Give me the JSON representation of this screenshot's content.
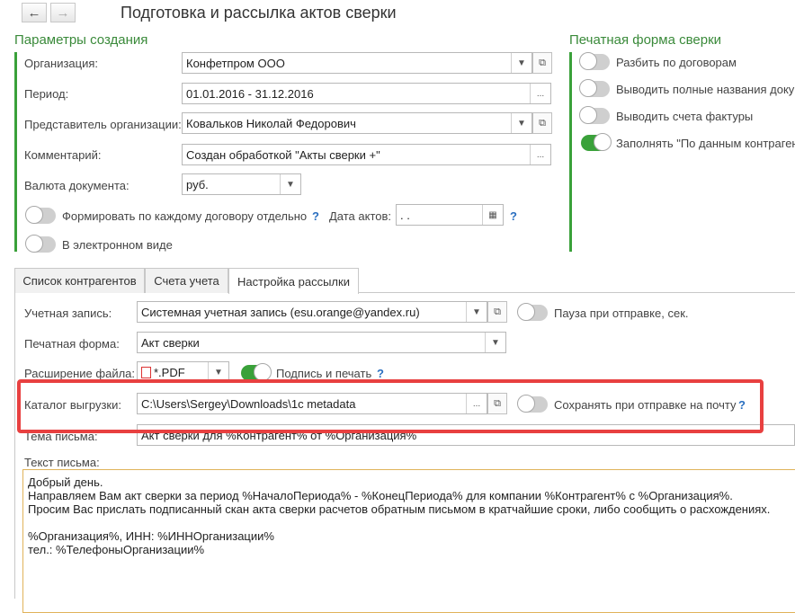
{
  "window": {
    "title": "Подготовка и рассылка актов сверки"
  },
  "nav": {
    "back": "←",
    "forward": "→"
  },
  "params": {
    "title": "Параметры создания",
    "org_label": "Организация:",
    "org_value": "Конфетпром ООО",
    "period_label": "Период:",
    "period_value": "01.01.2016 - 31.12.2016",
    "rep_label": "Представитель организации:",
    "rep_value": "Ковальков Николай Федорович",
    "comment_label": "Комментарий:",
    "comment_value": "Создан обработкой \"Акты сверки +\"",
    "currency_label": "Валюта документа:",
    "currency_value": "руб.",
    "each_contract_label": "Формировать по каждому договору отдельно",
    "acts_date_label": "Дата актов:",
    "acts_date_value": " .  .",
    "electronic_label": "В электронном виде"
  },
  "print_form": {
    "title": "Печатная форма сверки",
    "items": [
      {
        "label": "Разбить по договорам",
        "on": false
      },
      {
        "label": "Выводить полные названия документов",
        "on": false
      },
      {
        "label": "Выводить счета фактуры",
        "on": false
      },
      {
        "label": "Заполнять \"По данным контрагента\"",
        "on": true
      }
    ]
  },
  "tabs": [
    {
      "label": "Список контрагентов",
      "active": false
    },
    {
      "label": "Счета учета",
      "active": false
    },
    {
      "label": "Настройка рассылки",
      "active": true
    }
  ],
  "mailing": {
    "account_label": "Учетная запись:",
    "account_value": "Системная учетная запись (esu.orange@yandex.ru)",
    "pause_label": "Пауза при отправке, сек.",
    "printform_label": "Печатная форма:",
    "printform_value": "Акт сверки",
    "ext_label": "Расширение файла:",
    "ext_value": "*.PDF",
    "sign_label": "Подпись и печать",
    "catalog_label": "Каталог выгрузки:",
    "catalog_value": "C:\\Users\\Sergey\\Downloads\\1c metadata",
    "save_label": "Сохранять при отправке на почту",
    "subject_label": "Тема письма:",
    "subject_value": "Акт сверки для %Контрагент% от %Организация%",
    "body_label": "Текст письма:",
    "body_lines": [
      "Добрый день.",
      "Направляем Вам акт сверки за период %НачалоПериода% - %КонецПериода% для компании %Контрагент% с %Организация%.",
      "Просим Вас прислать подписанный скан акта сверки расчетов обратным письмом в кратчайшие сроки, либо сообщить о расхождениях.",
      "",
      "%Организация%, ИНН: %ИННОрганизации%",
      "тел.: %ТелефоныОрганизации%"
    ]
  },
  "help": "?",
  "icons": {
    "dropdown": "▼",
    "open": "⧉",
    "select": "...",
    "calendar": "▦"
  },
  "colors": {
    "accent_green": "#3aa13a",
    "highlight_red": "#e84040",
    "help_blue": "#2a6fc0"
  }
}
